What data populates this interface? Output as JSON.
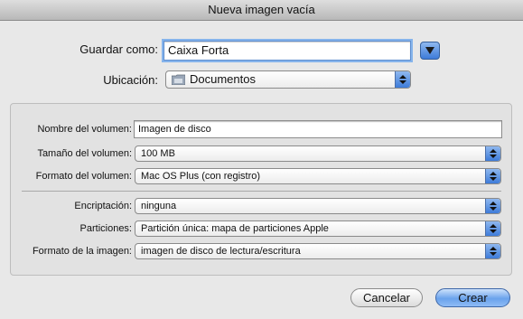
{
  "window": {
    "title": "Nueva imagen vacía"
  },
  "save": {
    "label": "Guardar como:",
    "value": "Caixa Forta"
  },
  "location": {
    "label": "Ubicación:",
    "value": "Documentos"
  },
  "fields": {
    "volume_name": {
      "label": "Nombre del volumen:",
      "value": "Imagen de disco"
    },
    "volume_size": {
      "label": "Tamaño del volumen:",
      "value": "100 MB"
    },
    "volume_format": {
      "label": "Formato del volumen:",
      "value": "Mac OS Plus (con registro)"
    },
    "encryption": {
      "label": "Encriptación:",
      "value": "ninguna"
    },
    "partitions": {
      "label": "Particiones:",
      "value": "Partición única: mapa de particiones Apple"
    },
    "image_format": {
      "label": "Formato de la imagen:",
      "value": "imagen de disco de lectura/escritura"
    }
  },
  "buttons": {
    "cancel": "Cancelar",
    "create": "Crear"
  },
  "icons": {
    "disclosure": "chevron-down-icon",
    "popup": "updown-arrows-icon",
    "folder": "folder-icon"
  },
  "colors": {
    "accent": "#3d7bd9",
    "focus_ring": "#86b4ec"
  }
}
